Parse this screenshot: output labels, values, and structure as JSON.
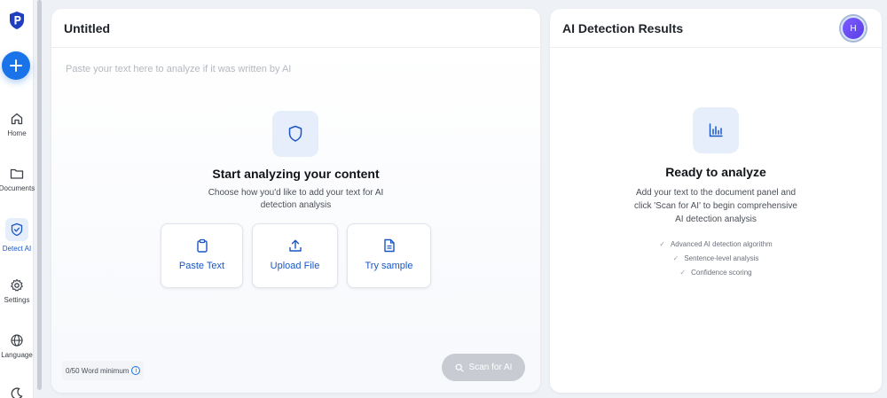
{
  "colors": {
    "accent": "#1a73e8",
    "accent_text": "#1a56c4",
    "tile_bg": "#e6eefb",
    "disabled_button": "#c8cbd1"
  },
  "sidebar": {
    "logo": "brand-shield-logo",
    "new_button_icon": "plus-icon",
    "items": [
      {
        "label": "Home",
        "icon": "home-icon"
      },
      {
        "label": "Documents",
        "icon": "folder-icon"
      },
      {
        "label": "Detect AI",
        "icon": "shield-check-icon",
        "active": true
      },
      {
        "label": "Settings",
        "icon": "gear-icon"
      },
      {
        "label": "Language",
        "icon": "globe-icon"
      }
    ],
    "theme_icon": "moon-icon"
  },
  "document": {
    "title": "Untitled",
    "placeholder": "Paste your text here to analyze if it was written by AI",
    "empty_state": {
      "icon": "shield-icon",
      "title": "Start analyzing your content",
      "subtitle": "Choose how you'd like to add your text for AI detection analysis"
    },
    "options": [
      {
        "label": "Paste Text",
        "icon": "clipboard-icon"
      },
      {
        "label": "Upload File",
        "icon": "upload-icon"
      },
      {
        "label": "Try sample",
        "icon": "file-text-icon"
      }
    ],
    "footer": {
      "word_count": "0/50 Word minimum",
      "info_glyph": "i",
      "scan_label": "Scan for AI"
    }
  },
  "results": {
    "title": "AI Detection Results",
    "avatar_initial": "H",
    "empty_state": {
      "icon": "bar-chart-icon",
      "title": "Ready to analyze",
      "subtitle": "Add your text to the document panel and click 'Scan for AI' to begin comprehensive AI detection analysis"
    },
    "features": [
      "Advanced AI detection algorithm",
      "Sentence-level analysis",
      "Confidence scoring"
    ],
    "feature_glyph": "✓"
  }
}
